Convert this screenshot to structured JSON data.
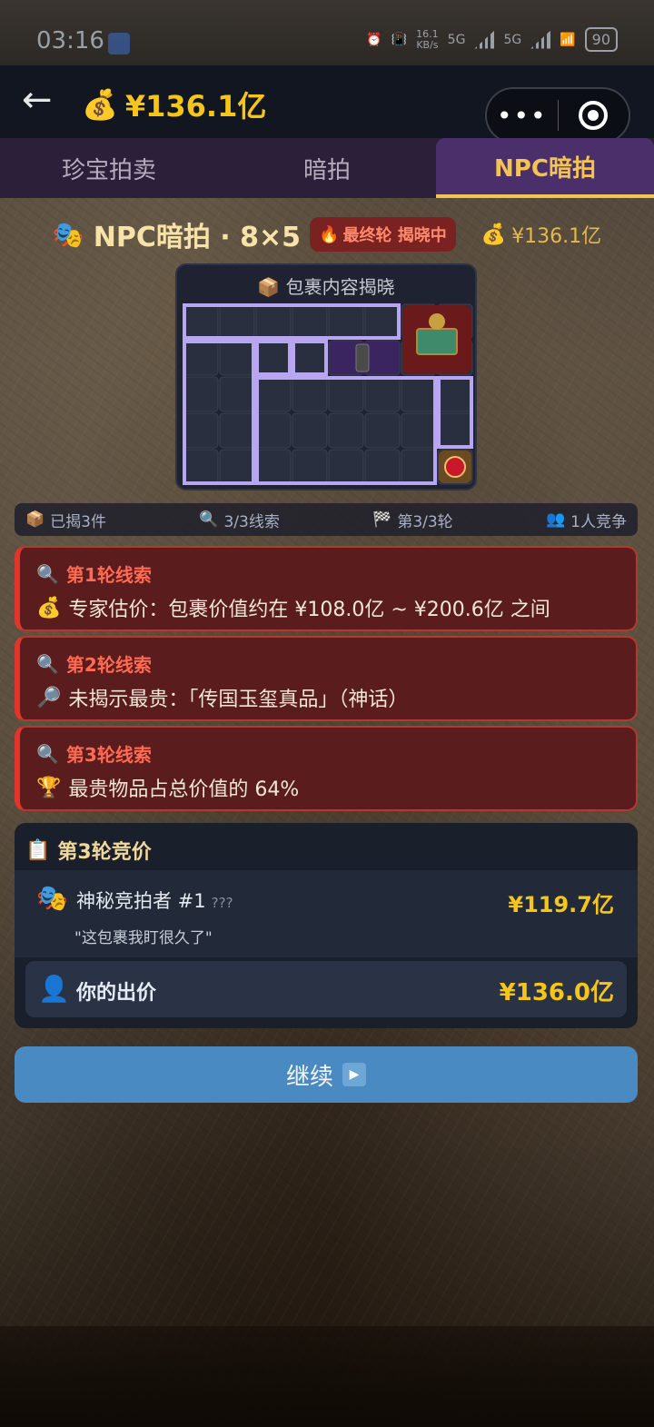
{
  "status_bar": {
    "time": "03:16",
    "net_rate_value": "16.1",
    "net_rate_unit": "KB/s",
    "signal1": "5G",
    "signal2": "5G",
    "battery": "90"
  },
  "header": {
    "back_icon": "arrow-left-icon",
    "money_icon": "money-bag-icon",
    "money": "¥136.1亿",
    "capsule_more": "•••",
    "capsule_target_icon": "target-icon"
  },
  "tabs": [
    {
      "label": "珍宝拍卖",
      "active": false
    },
    {
      "label": "暗拍",
      "active": false
    },
    {
      "label": "NPC暗拍",
      "active": true
    }
  ],
  "round": {
    "masks_icon": "masks-icon",
    "title": "NPC暗拍 · 8×5",
    "badge_icon": "fire-icon",
    "badge": "最终轮 揭晓中",
    "money": "¥136.1亿"
  },
  "grid": {
    "title": "包裹内容揭晓",
    "title_icon": "package-icon",
    "cols": 8,
    "rows": 5
  },
  "stats": {
    "revealed": "已揭3件",
    "clues": "3/3线索",
    "round": "第3/3轮",
    "competitors": "1人竞争"
  },
  "clues": [
    {
      "title": "第1轮线索",
      "icon": "money-bag-icon",
      "text": "专家估价：包裹价值约在 ¥108.0亿 ~ ¥200.6亿 之间"
    },
    {
      "title": "第2轮线索",
      "icon": "magnifier-icon",
      "text": "未揭示最贵：「传国玉玺真品」（神话）"
    },
    {
      "title": "第3轮线索",
      "icon": "trophy-icon",
      "text": "最贵物品占总价值的 64%"
    }
  ],
  "bidding": {
    "title": "第3轮竞价",
    "npc": {
      "name": "神秘竞拍者 #1",
      "tag": "???",
      "quote": "\"这包裹我盯很久了\"",
      "price": "¥119.7亿"
    },
    "mine": {
      "label": "你的出价",
      "price": "¥136.0亿"
    }
  },
  "continue": {
    "label": "继续",
    "icon": "play-icon"
  },
  "colors": {
    "accent_gold": "#f5c518",
    "tab_active_bg": "#4a2f6a",
    "clue_bg": "#5a1c1c",
    "clue_border": "#e0352a",
    "button_blue": "#4a8ac2"
  }
}
